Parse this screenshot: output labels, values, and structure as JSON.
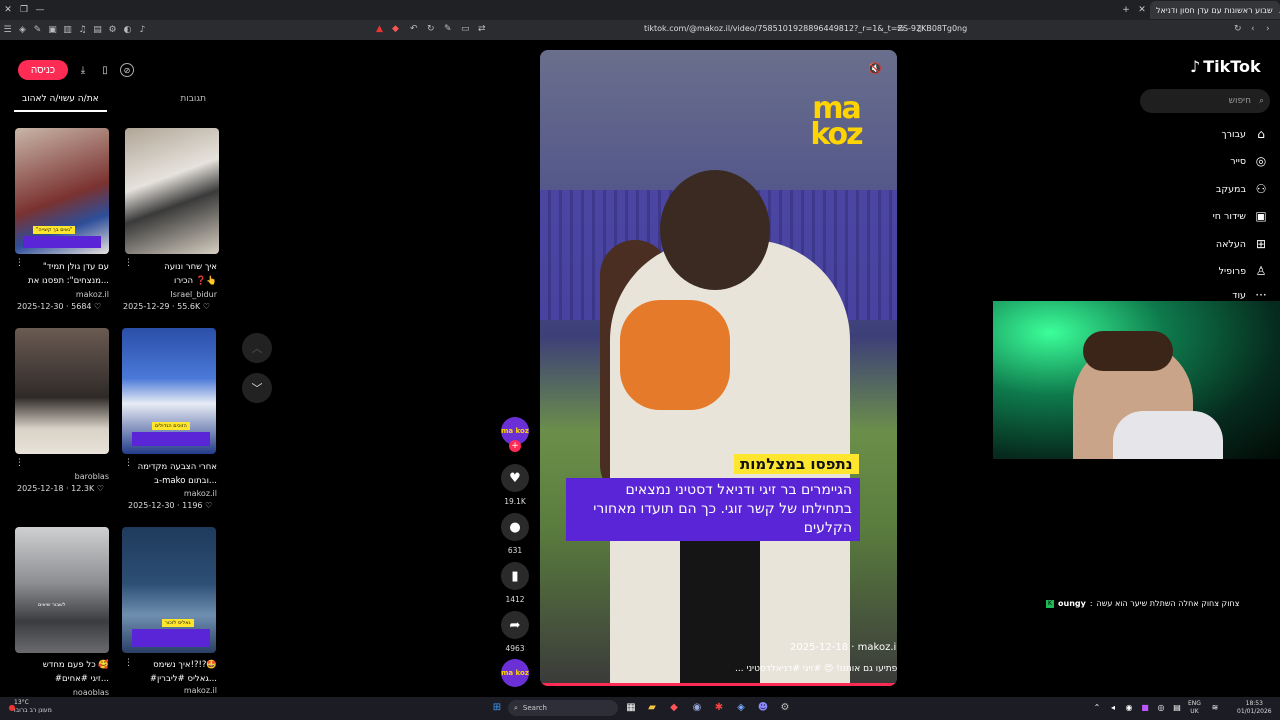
{
  "browser": {
    "active_tab_title": "שבוע ראשונות עם עדן חסון ודניאל",
    "url": "tiktok.com/@makoz.il/video/7585101928896449812?_r=1&_t=ZS-92KB08Tg0ng"
  },
  "left_panel": {
    "login_label": "כניסה",
    "tabs": [
      {
        "label": "את/ה עשוי/ה לאהוב",
        "active": true
      },
      {
        "label": "תגובות",
        "active": false
      }
    ],
    "cards": [
      {
        "title": "\"עם עדן גולן תמיד",
        "title2": "מנצחים\": תפסנו את...",
        "user": "makoz.il",
        "date": "2025-12-30",
        "likes": "5684",
        "thumb_tag": "\"גאים בך קיצייה\""
      },
      {
        "title": "איך שחר ונועה",
        "title2": "הכירו ❓👆",
        "user": "Israel_bidur",
        "date": "2025-12-29",
        "likes": "55.6K",
        "thumb_tag": ""
      },
      {
        "title": "",
        "title2": "",
        "user": "baroblas",
        "date": "2025-12-18",
        "likes": "12.3K",
        "thumb_tag": ""
      },
      {
        "title": "אחרי הצבעה מקדימה",
        "title2": "ב-mako ובתום...",
        "user": "makoz.il",
        "date": "2025-12-30",
        "likes": "1196",
        "thumb_tag": "הזוכים הגדולים"
      },
      {
        "title": "כל פעם מחדש 🥰",
        "title2": "#זיגי #אחים...",
        "user": "noaoblas",
        "date": "",
        "likes": "",
        "thumb_tag": "לשבור שיאים"
      },
      {
        "title": "איך נשימס!?!?🤩",
        "title2": "#גאליס #ליברין...",
        "user": "makoz.il",
        "date": "",
        "likes": "",
        "thumb_tag": "גאליס לזכור"
      }
    ]
  },
  "video": {
    "brand_line1": "ma",
    "brand_line2": "koz",
    "caption_title": "נתפסו במצלמות",
    "caption_body": "הגיימרים בר זיגי ודניאל דסטיני נמצאים בתחילתו של קשר זוגי. כך הם תועדו מאחורי הקלעים",
    "date_user": "2025-12-18 · makoz.il",
    "description": "הפתיעו גם אותנו! 😍 #זיגי #דניאלדסטיני ...",
    "progress": 1.0
  },
  "actions": {
    "avatar_text": "ma koz",
    "likes": "19.1K",
    "comments": "631",
    "saves": "1412",
    "shares": "4963"
  },
  "sidebar": {
    "logo": "TikTok",
    "search_placeholder": "חיפוש",
    "nav": [
      "עבורך",
      "סייר",
      "במעקב",
      "שידור חי",
      "העלאה",
      "פרופיל",
      "עוד"
    ]
  },
  "chat": {
    "user": "oungy",
    "message": "צחוק צחוק אחלה השתלת שיער הוא עשה"
  },
  "taskbar": {
    "weather_temp": "13°C",
    "weather_desc": "מעונן רב ברובו",
    "search_placeholder": "Search",
    "lang": "ENG",
    "lang2": "UK",
    "time": "18:53",
    "date": "01/01/2026"
  },
  "colors": {
    "accent": "#fe2c55",
    "brand_purple": "#5a25d6",
    "brand_yellow": "#ffe62e"
  }
}
